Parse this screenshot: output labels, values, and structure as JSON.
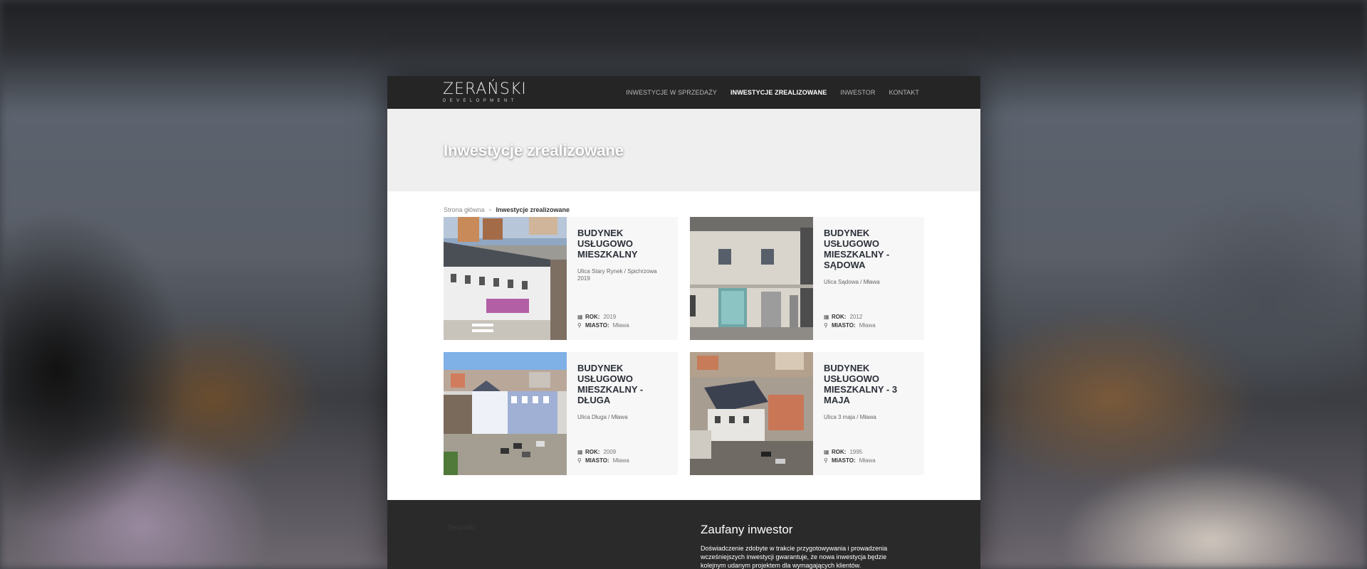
{
  "header": {
    "logo_main": "ZERAŃSKI",
    "logo_sub": "DEVELOPMENT",
    "nav": [
      {
        "label": "INWESTYCJE W SPRZEDAŻY",
        "active": false
      },
      {
        "label": "INWESTYCJE ZREALIZOWANE",
        "active": true
      },
      {
        "label": "INWESTOR",
        "active": false
      },
      {
        "label": "KONTAKT",
        "active": false
      }
    ]
  },
  "hero": {
    "title": "Inwestycje zrealizowane"
  },
  "breadcrumb": {
    "home": "Strona główna",
    "separator": "»",
    "current": "Inwestycje zrealizowane"
  },
  "labels": {
    "year": "ROK:",
    "city": "MIASTO:"
  },
  "cards": [
    {
      "title": "BUDYNEK USŁUGOWO MIESZKALNY",
      "address": "Ulica Stary Rynek / Spichrzowa 2019",
      "year": "2019",
      "city": "Mława"
    },
    {
      "title": "BUDYNEK USŁUGOWO MIESZKALNY - SĄDOWA",
      "address": "Ulica Sądowa / Mława",
      "year": "2012",
      "city": "Mława"
    },
    {
      "title": "BUDYNEK USŁUGOWO MIESZKALNY - DŁUGA",
      "address": "Ulica Długa / Mława",
      "year": "2009",
      "city": "Mława"
    },
    {
      "title": "BUDYNEK USŁUGOWO MIESZKALNY - 3 MAJA",
      "address": "Ulica 3 maja / Mława",
      "year": "1995",
      "city": "Mława"
    }
  ],
  "footer": {
    "muted_label": "Zeranski",
    "heading": "Zaufany inwestor",
    "text": "Doświadczenie zdobyte w trakcie przygotowywania i prowadzenia wcześniejszych inwestycji gwarantuje, że nowa inwestycja będzie kolejnym udanym projektem dla wymagających klientów."
  },
  "icons": {
    "calendar": "calendar-icon",
    "location": "map-pin-icon"
  }
}
